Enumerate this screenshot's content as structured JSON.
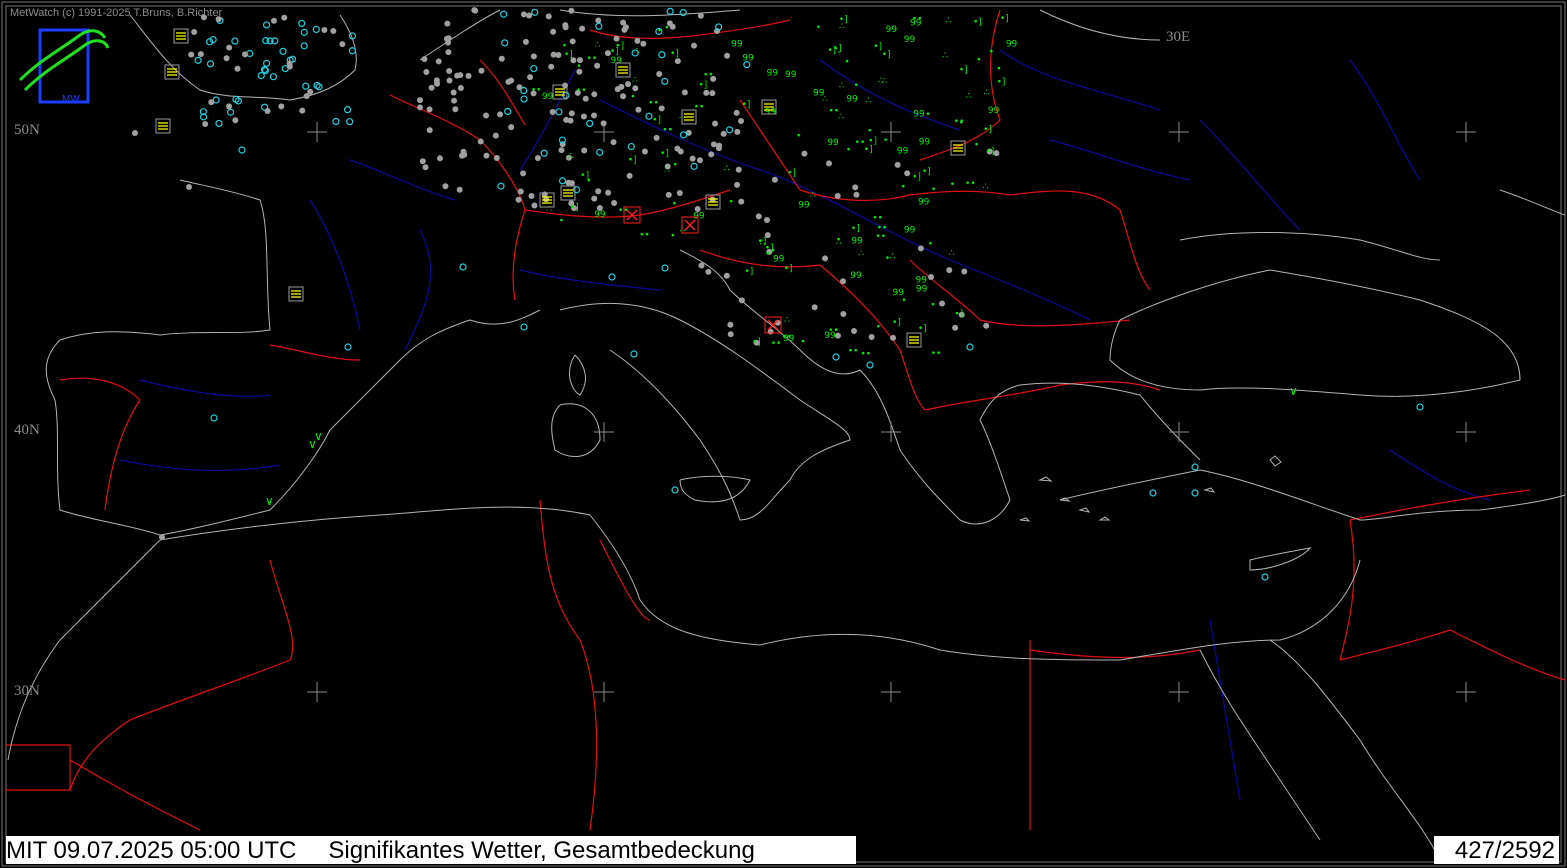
{
  "app": {
    "credit": "MetWatch  (c) 1991-2025 T.Bruns, B.Richter"
  },
  "map": {
    "region": "Europe / Mediterranean",
    "grid_labels": {
      "lat50": "50N",
      "lat40": "40N",
      "lat30": "30N",
      "lon30": "30E"
    },
    "colors": {
      "background": "#000000",
      "coastline": "#b4b4b4",
      "borders": "#e01010",
      "rivers": "#0a0a9a",
      "grid_cross": "#8a8a8a",
      "precip_symbols": "#00ee00",
      "cloud_cover_dots": "#a0a0a0",
      "clear_sky_circles": "#20d0e0",
      "fog_symbols": "#ffff00",
      "thunder_symbols": "#ff2020"
    },
    "icons": [
      "metwatch-logo-icon",
      "drizzle-symbol-icon",
      "rain-shower-symbol-icon",
      "fog-symbol-icon",
      "thunderstorm-symbol-icon",
      "cloud-cover-icon"
    ]
  },
  "status": {
    "datetime": "MIT 09.07.2025 05:00 UTC",
    "parameter": "Signifikantes Wetter, Gesamtbedeckung",
    "count": "427/2592"
  }
}
